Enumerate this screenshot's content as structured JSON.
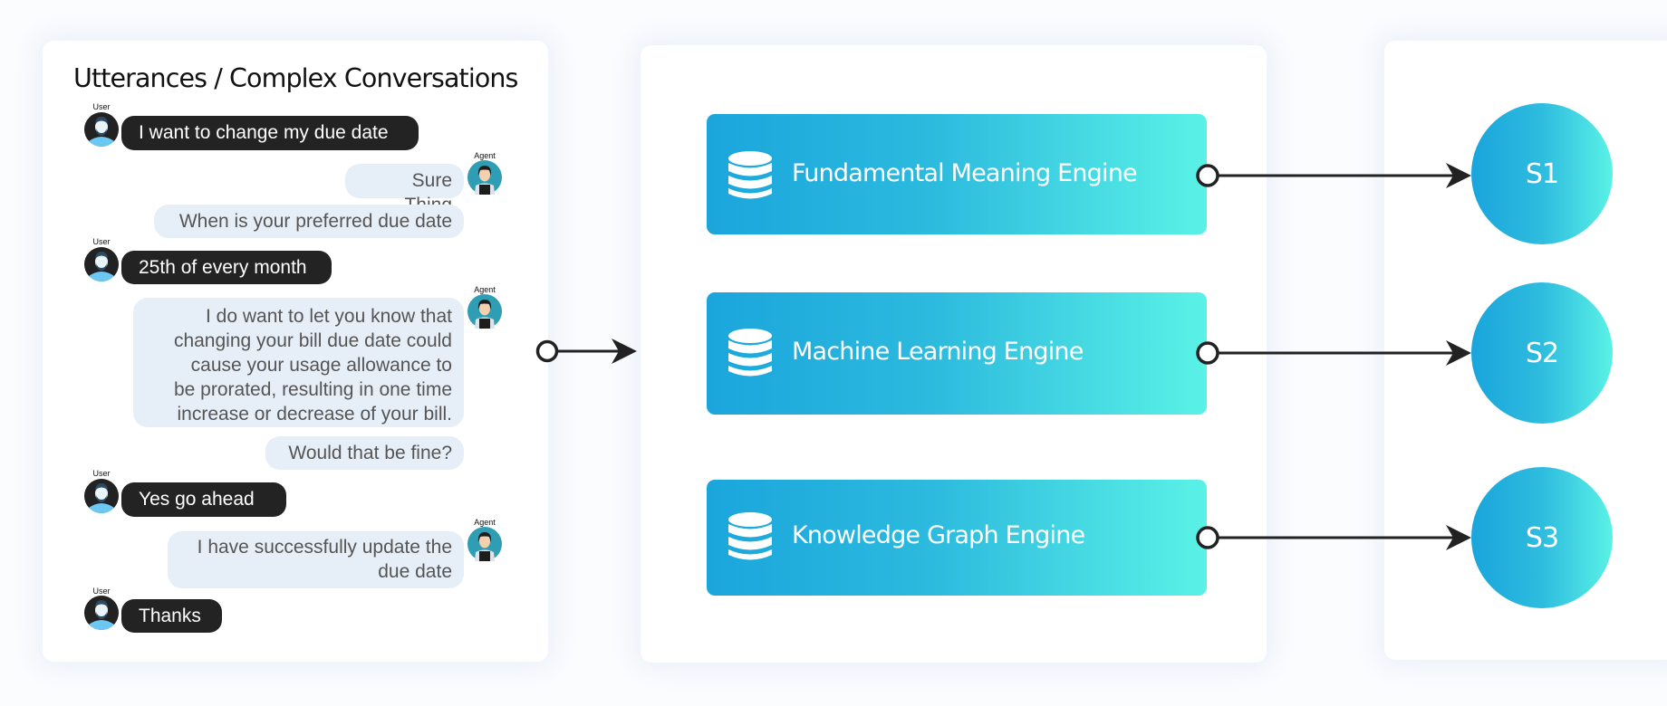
{
  "conversation": {
    "title": "Utterances / Complex Conversations",
    "speaker_labels": {
      "user": "User",
      "agent": "Agent"
    },
    "messages": [
      {
        "speaker": "user",
        "text": "I want to change my due date"
      },
      {
        "speaker": "agent",
        "text": "Sure Thing"
      },
      {
        "speaker": "agent",
        "text": "When is your preferred due date"
      },
      {
        "speaker": "user",
        "text": "25th of every month"
      },
      {
        "speaker": "agent",
        "text": "I do want to let you know that\nchanging your bill due date could\ncause your usage allowance to\nbe prorated, resulting in one time\nincrease or decrease of your bill."
      },
      {
        "speaker": "agent",
        "text": "Would that be fine?"
      },
      {
        "speaker": "user",
        "text": "Yes go ahead"
      },
      {
        "speaker": "agent",
        "text": "I have successfully update the\ndue date"
      },
      {
        "speaker": "user",
        "text": "Thanks"
      }
    ]
  },
  "engines": [
    {
      "label": "Fundamental Meaning Engine",
      "icon": "database-icon"
    },
    {
      "label": "Machine Learning Engine",
      "icon": "database-icon"
    },
    {
      "label": "Knowledge Graph Engine",
      "icon": "database-icon"
    }
  ],
  "outputs": [
    {
      "label": "S1"
    },
    {
      "label": "S2"
    },
    {
      "label": "S3"
    }
  ],
  "colors": {
    "gradient_start": "#1aa6dc",
    "gradient_end": "#5af2e6",
    "user_bubble": "#232323",
    "agent_bubble": "#e6eef8",
    "connector": "#222222"
  }
}
